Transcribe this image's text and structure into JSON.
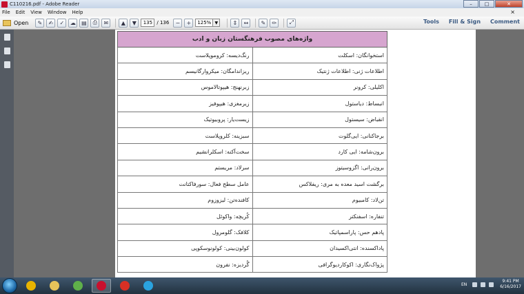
{
  "window": {
    "title": "C110216.pdf - Adobe Reader",
    "buttons": {
      "minimize": "–",
      "maximize": "□",
      "close": "✕"
    }
  },
  "menu": {
    "items": [
      "File",
      "Edit",
      "View",
      "Window",
      "Help"
    ],
    "close_label": "×"
  },
  "toolbar": {
    "open_label": "Open",
    "page_current": "135",
    "page_total": "/ 136",
    "zoom": "125%",
    "right_links": [
      "Tools",
      "Fill & Sign",
      "Comment"
    ]
  },
  "document": {
    "table_header": "واژه‌های مصوب فرهنگستان زبان و ادب",
    "rows": [
      [
        "استخوانگان: اسکلت",
        "رنگ‌دیسه: کروموپلاست"
      ],
      [
        "اطلاعات ژنی: اطلاعات ژنتیک",
        "ریزاندامگان: میکروارگانیسم"
      ],
      [
        "اکلیلی: کرونر",
        "زبرنهنج: هیپوتالاموس"
      ],
      [
        "انبساط: دیاستول",
        "زیرمغزی: هیپوفیز"
      ],
      [
        "انقباض: سیستول",
        "زیست‌یار: پروبیوتیک"
      ],
      [
        "برجاکنانی: ایی‌گلوت",
        "سبزینه: کلروپلاست"
      ],
      [
        "برون‌شامه: ایی کارد",
        "سخت‌آکنه: اسکلرانشیم"
      ],
      [
        "برون‌رانی: اگزوسیتوز",
        "سرلاد: مریستم"
      ],
      [
        "برگشت اسید معده به مری: ریفلاکس",
        "عامل سطح فعال: سورفاکتانت"
      ],
      [
        "تن‌لاد: کامبیوم",
        "کافنده‌تن: لیزوزوم"
      ],
      [
        "تنفاره: اسفنکتر",
        "کُریچه: واکوئل"
      ],
      [
        "پادهم حس: پاراسمپاتیک",
        "کلافک: گلومرول"
      ],
      [
        "پاداکسنده: انتی‌اکسیدان",
        "کولون‌بینی: کولونوسکوپی"
      ],
      [
        "پژواک‌نگاری: اکوکاردیوگرافی",
        "گُردیزه: نفرون"
      ]
    ]
  },
  "taskbar": {
    "apps": [
      {
        "name": "chrome",
        "color": "#e8b400"
      },
      {
        "name": "explorer",
        "color": "#e6c35a"
      },
      {
        "name": "media",
        "color": "#5fb04a"
      },
      {
        "name": "acrobat",
        "color": "#c8102e"
      },
      {
        "name": "chrome2",
        "color": "#d93025"
      },
      {
        "name": "telegram",
        "color": "#2aa3df"
      }
    ],
    "lang": "EN",
    "time": "9:41 PM",
    "date": "6/16/2017"
  }
}
